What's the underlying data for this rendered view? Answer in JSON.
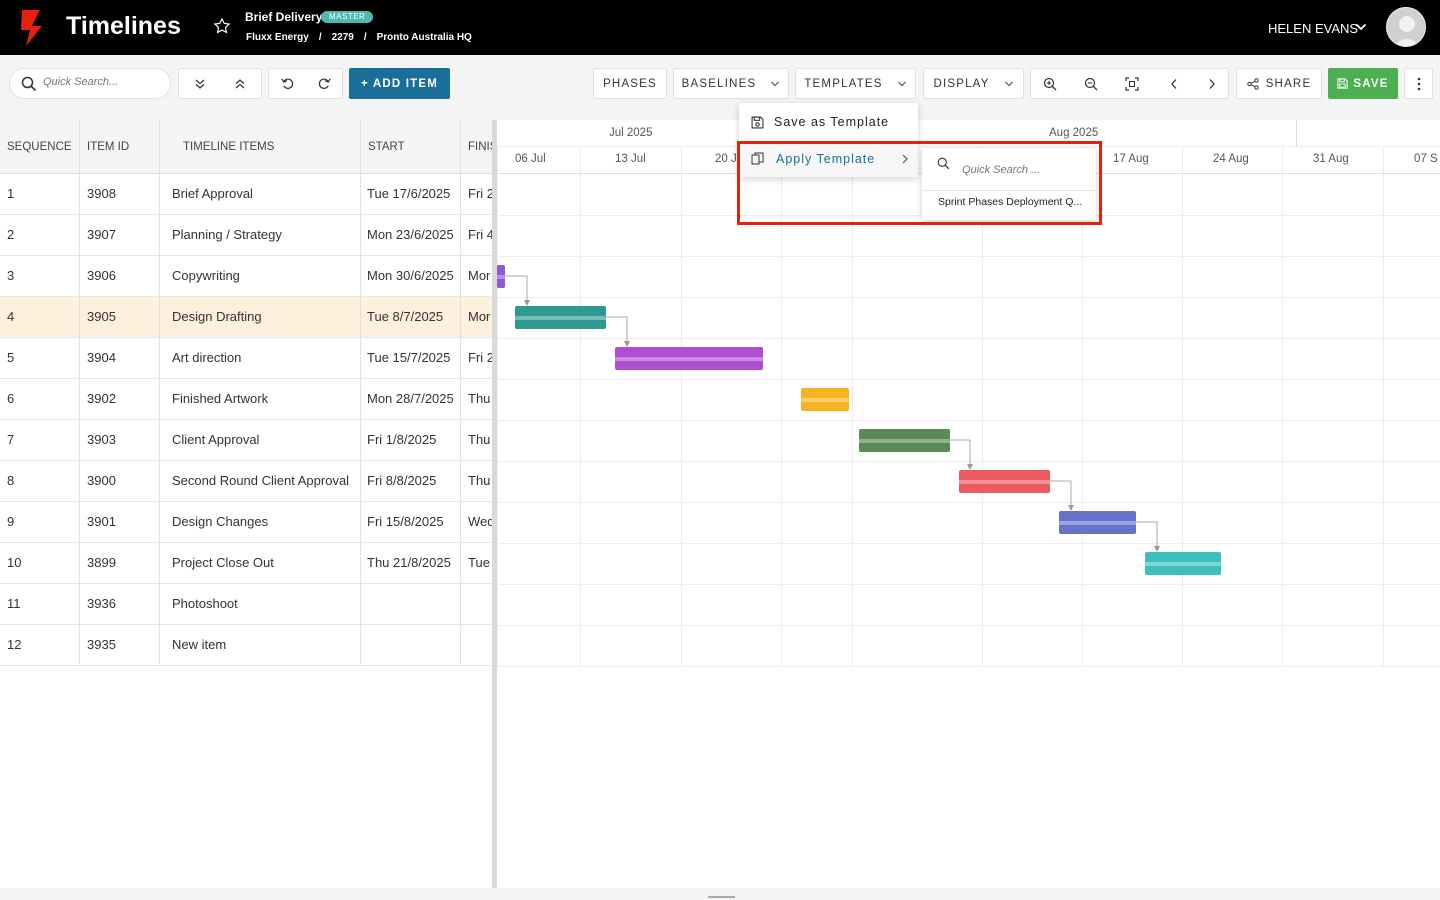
{
  "header": {
    "app_title": "Timelines",
    "brief_title": "Brief Delivery",
    "badge": "MASTER",
    "breadcrumbs": [
      "Fluxx Energy",
      "/",
      "2279",
      "/",
      "Pronto Australia HQ"
    ],
    "user_name": "HELEN EVANS",
    "logo_color": "#e4200e"
  },
  "toolbar": {
    "search_placeholder": "Quick Search...",
    "add_item": "+ ADD ITEM",
    "phases": "PHASES",
    "baselines": "BASELINES",
    "templates": "TEMPLATES",
    "display": "DISPLAY",
    "share": "SHARE",
    "save": "SAVE",
    "accent_color": "#1a6f9a",
    "save_color": "#4cb050"
  },
  "grid": {
    "columns": [
      "SEQUENCE",
      "ITEM ID",
      "TIMELINE ITEMS",
      "START",
      "FINISH"
    ],
    "rows": [
      {
        "seq": "1",
        "id": "3908",
        "name": "Brief Approval",
        "start": "Tue 17/6/2025",
        "finish": "Fri 2"
      },
      {
        "seq": "2",
        "id": "3907",
        "name": "Planning / Strategy",
        "start": "Mon 23/6/2025",
        "finish": "Fri 4"
      },
      {
        "seq": "3",
        "id": "3906",
        "name": "Copywriting",
        "start": "Mon 30/6/2025",
        "finish": "Mor"
      },
      {
        "seq": "4",
        "id": "3905",
        "name": "Design Drafting",
        "start": "Tue 8/7/2025",
        "finish": "Mor"
      },
      {
        "seq": "5",
        "id": "3904",
        "name": "Art direction",
        "start": "Tue 15/7/2025",
        "finish": "Fri 2"
      },
      {
        "seq": "6",
        "id": "3902",
        "name": "Finished Artwork",
        "start": "Mon 28/7/2025",
        "finish": "Thu"
      },
      {
        "seq": "7",
        "id": "3903",
        "name": "Client Approval",
        "start": "Fri 1/8/2025",
        "finish": "Thu"
      },
      {
        "seq": "8",
        "id": "3900",
        "name": "Second Round Client Approval",
        "start": "Fri 8/8/2025",
        "finish": "Thu"
      },
      {
        "seq": "9",
        "id": "3901",
        "name": "Design Changes",
        "start": "Fri 15/8/2025",
        "finish": "Wed"
      },
      {
        "seq": "10",
        "id": "3899",
        "name": "Project Close Out",
        "start": "Thu 21/8/2025",
        "finish": "Tue"
      },
      {
        "seq": "11",
        "id": "3936",
        "name": "Photoshoot",
        "start": "",
        "finish": ""
      },
      {
        "seq": "12",
        "id": "3935",
        "name": "New item",
        "start": "",
        "finish": ""
      }
    ],
    "highlight_row": 3,
    "highlight_color": "#fdf0dc"
  },
  "gantt": {
    "months": [
      "Jul 2025",
      "Aug 2025"
    ],
    "weeks": [
      "06 Jul",
      "13 Jul",
      "20 J",
      "17 Aug",
      "24 Aug",
      "31 Aug",
      "07 S"
    ],
    "bar_colors": [
      "#8e5bd1",
      "#2e9891",
      "#b04ed1",
      "#f4b422",
      "#5a8a55",
      "#eb5a5e",
      "#6673c9",
      "#3cbfbf"
    ]
  },
  "templates_menu": {
    "save_as_template": "Save as Template",
    "apply_template": "Apply Template",
    "submenu_search_placeholder": "Quick Search ...",
    "templates": [
      "Sprint Phases Deployment Q..."
    ]
  }
}
